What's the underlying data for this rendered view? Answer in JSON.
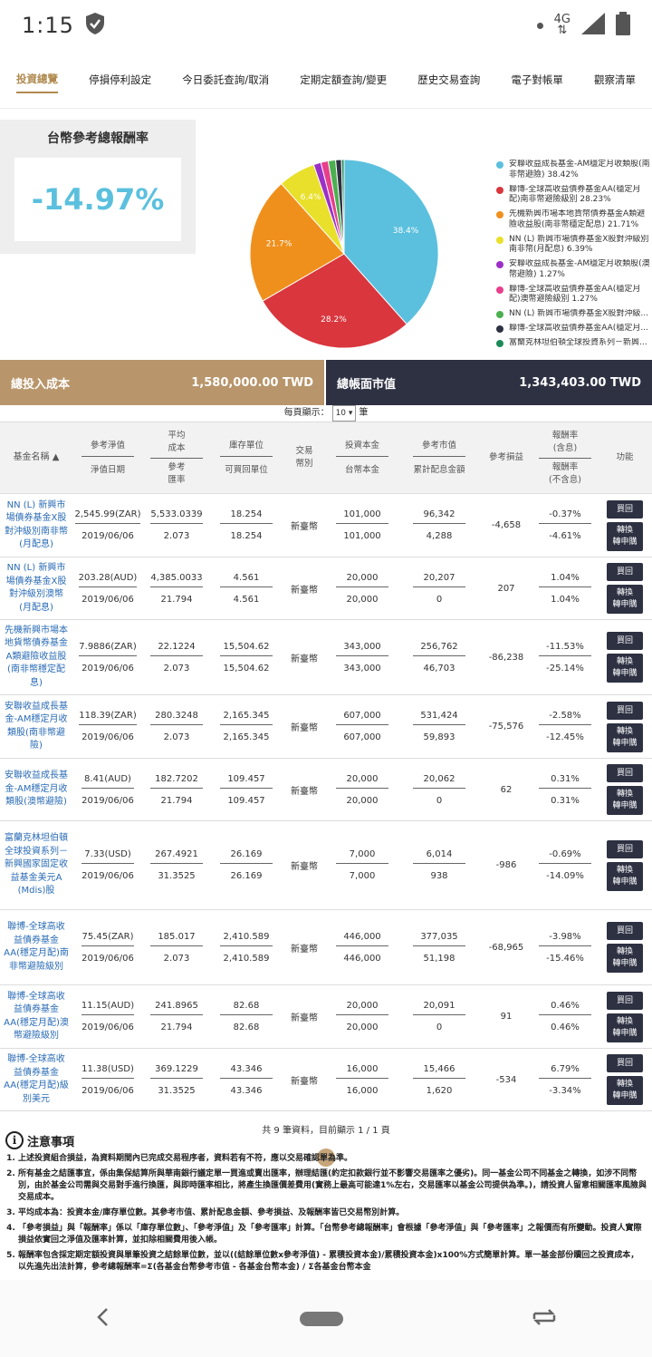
{
  "status": {
    "time": "1:15",
    "network": "4G"
  },
  "tabs": [
    "投資總覽",
    "停損停利設定",
    "今日委託查詢/取消",
    "定期定額查詢/變更",
    "歷史交易查詢",
    "電子對帳單",
    "觀察清單"
  ],
  "summary": {
    "title": "台幣參考總報酬率",
    "value": "-14.97%"
  },
  "chart_data": {
    "type": "pie",
    "slices": [
      {
        "label": "安聯收益成長基金-AM穩定月收類股(南非幣避險)",
        "value": 38.42,
        "color": "#5bc0de",
        "text": "38.4%"
      },
      {
        "label": "聯博-全球高收益債券基金AA(穩定月配)南非幣避險級別",
        "value": 28.23,
        "color": "#d9363e",
        "text": "28.2%"
      },
      {
        "label": "先機新興市場本地貨幣債券基金A類避險收益股(南非幣穩定配息)",
        "value": 21.71,
        "color": "#f0901c",
        "text": "21.7%"
      },
      {
        "label": "NN (L) 新興市場債券基金X股對沖級別南非幣(月配息)",
        "value": 6.39,
        "color": "#e8e02a",
        "text": "6.4%"
      },
      {
        "label": "安聯收益成長基金-AM穩定月收類股(澳幣避險)",
        "value": 1.27,
        "color": "#9b30c8",
        "text": ""
      },
      {
        "label": "聯博-全球高收益債券基金AA(穩定月配)澳幣避險級別",
        "value": 1.27,
        "color": "#e83e8c",
        "text": ""
      },
      {
        "label": "NN (L) 新興市場債券基金X股對沖級...",
        "value": 1.27,
        "color": "#4caf50",
        "text": ""
      },
      {
        "label": "聯博-全球高收益債券基金AA(穩定月...",
        "value": 1.0,
        "color": "#2d3142",
        "text": ""
      },
      {
        "label": "富蘭克林坦伯頓全球投資系列－新興...",
        "value": 0.44,
        "color": "#1e8a5a",
        "text": ""
      }
    ]
  },
  "legend": [
    "安聯收益成長基金-AM穩定月收類股(南非幣避險) 38.42%",
    "聯博-全球高收益債券基金AA(穩定月配)南非幣避險級別 28.23%",
    "先機新興市場本地貨幣債券基金A類避險收益股(南非幣穩定配息) 21.71%",
    "NN (L) 新興市場債券基金X股對沖級別南非幣(月配息) 6.39%",
    "安聯收益成長基金-AM穩定月收類股(澳幣避險) 1.27%",
    "聯博-全球高收益債券基金AA(穩定月配)澳幣避險級別 1.27%",
    "NN (L) 新興市場債券基金X股對沖級...",
    "聯博-全球高收益債券基金AA(穩定月...",
    "富蘭克林坦伯頓全球投資系列－新興..."
  ],
  "totals": {
    "cost_label": "總投入成本",
    "cost_value": "1,580,000.00  TWD",
    "mkt_label": "總帳面市值",
    "mkt_value": "1,343,403.00  TWD"
  },
  "pagesize": {
    "label": "每頁顯示：",
    "value": "10 ▾",
    "unit": "筆"
  },
  "headers": {
    "name": "基金名稱 ▲",
    "nav_a": "參考淨值",
    "nav_b": "淨值日期",
    "avg_a": "平均",
    "avg_b": "成本",
    "avg_c": "參考",
    "avg_d": "匯率",
    "unit_a": "庫存單位",
    "unit_b": "可買回單位",
    "cur_a": "交易",
    "cur_b": "幣別",
    "inv_a": "投資本金",
    "inv_b": "台幣本金",
    "mkt_a": "參考市值",
    "mkt_b": "累計配息金額",
    "pl": "參考損益",
    "rate_a": "報酬率",
    "rate_b": "(含息)",
    "rate_c": "報酬率",
    "rate_d": "(不含息)",
    "act": "功能"
  },
  "buttons": {
    "redeem": "買回",
    "switch_a": "轉換",
    "switch_b": "轉申購"
  },
  "rows": [
    {
      "name": "NN (L) 新興市場債券基金X股對沖級別南非幣(月配息)",
      "nav": "2,545.99(ZAR)",
      "date": "2019/06/06",
      "avg": "5,533.0339",
      "fx": "2.073",
      "unit": "18.254",
      "unit2": "18.254",
      "cur": "新臺幣",
      "inv": "101,000",
      "inv2": "101,000",
      "mkt": "96,342",
      "div": "4,288",
      "pl": "-4,658",
      "r1": "-0.37%",
      "r2": "-4.61%",
      "h": 70
    },
    {
      "name": "NN (L) 新興市場債券基金X股對沖級別澳幣(月配息)",
      "nav": "203.28(AUD)",
      "date": "2019/06/06",
      "avg": "4,385.0033",
      "fx": "21.794",
      "unit": "4.561",
      "unit2": "4.561",
      "cur": "新臺幣",
      "inv": "20,000",
      "inv2": "20,000",
      "mkt": "20,207",
      "div": "0",
      "pl": "207",
      "r1": "1.04%",
      "r2": "1.04%",
      "h": 69
    },
    {
      "name": "先機新興市場本地貨幣債券基金A類避險收益股(南非幣穩定配息)",
      "nav": "7.9886(ZAR)",
      "date": "2019/06/06",
      "avg": "22.1224",
      "fx": "2.073",
      "unit": "15,504.62",
      "unit2": "15,504.62",
      "cur": "新臺幣",
      "inv": "343,000",
      "inv2": "343,000",
      "mkt": "256,762",
      "div": "46,703",
      "pl": "-86,238",
      "r1": "-11.53%",
      "r2": "-25.14%",
      "h": 83
    },
    {
      "name": "安聯收益成長基金-AM穩定月收類股(南非幣避險)",
      "nav": "118.39(ZAR)",
      "date": "2019/06/06",
      "avg": "280.3248",
      "fx": "2.073",
      "unit": "2,165.345",
      "unit2": "2,165.345",
      "cur": "新臺幣",
      "inv": "607,000",
      "inv2": "607,000",
      "mkt": "531,424",
      "div": "59,893",
      "pl": "-75,576",
      "r1": "-2.58%",
      "r2": "-12.45%",
      "h": 70
    },
    {
      "name": "安聯收益成長基金-AM穩定月收類股(澳幣避險)",
      "nav": "8.41(AUD)",
      "date": "2019/06/06",
      "avg": "182.7202",
      "fx": "21.794",
      "unit": "109.457",
      "unit2": "109.457",
      "cur": "新臺幣",
      "inv": "20,000",
      "inv2": "20,000",
      "mkt": "20,062",
      "div": "0",
      "pl": "62",
      "r1": "0.31%",
      "r2": "0.31%",
      "h": 69
    },
    {
      "name": "富蘭克林坦伯頓全球投資系列－新興國家固定收益基金美元A (Mdis)股",
      "nav": "7.33(USD)",
      "date": "2019/06/06",
      "avg": "267.4921",
      "fx": "31.3525",
      "unit": "26.169",
      "unit2": "26.169",
      "cur": "新臺幣",
      "inv": "7,000",
      "inv2": "7,000",
      "mkt": "6,014",
      "div": "938",
      "pl": "-986",
      "r1": "-0.69%",
      "r2": "-14.09%",
      "h": 98
    },
    {
      "name": "聯博-全球高收益債券基金AA(穩定月配)南非幣避險級別",
      "nav": "75.45(ZAR)",
      "date": "2019/06/06",
      "avg": "185.017",
      "fx": "2.073",
      "unit": "2,410.589",
      "unit2": "2,410.589",
      "cur": "新臺幣",
      "inv": "446,000",
      "inv2": "446,000",
      "mkt": "377,035",
      "div": "51,198",
      "pl": "-68,965",
      "r1": "-3.98%",
      "r2": "-15.46%",
      "h": 83
    },
    {
      "name": "聯博-全球高收益債券基金AA(穩定月配)澳幣避險級別",
      "nav": "11.15(AUD)",
      "date": "2019/06/06",
      "avg": "241.8965",
      "fx": "21.794",
      "unit": "82.68",
      "unit2": "82.68",
      "cur": "新臺幣",
      "inv": "20,000",
      "inv2": "20,000",
      "mkt": "20,091",
      "div": "0",
      "pl": "91",
      "r1": "0.46%",
      "r2": "0.46%",
      "h": 70
    },
    {
      "name": "聯博-全球高收益債券基金AA(穩定月配)級別美元",
      "nav": "11.38(USD)",
      "date": "2019/06/06",
      "avg": "369.1229",
      "fx": "31.3525",
      "unit": "43.346",
      "unit2": "43.346",
      "cur": "新臺幣",
      "inv": "16,000",
      "inv2": "16,000",
      "mkt": "15,466",
      "div": "1,620",
      "pl": "-534",
      "r1": "6.79%",
      "r2": "-3.34%",
      "h": 69
    }
  ],
  "footer": {
    "info": "共 9 筆資料，目前顯示 1 / 1 頁",
    "page": "1"
  },
  "notes": {
    "title": "注意事項",
    "items": [
      "上述投資組合損益，為資料期間內已完成交易程序者，資料若有不符，應以交易確認單為準。",
      "所有基金之結匯事宜，係由集保結算所與華南銀行議定單一買進或賣出匯率，辦理結匯(約定扣款銀行並不影響交易匯率之優劣)。同一基金公司不同基金之轉換，如涉不同幣別，由於基金公司需與交易對手進行換匯，與即時匯率相比，將產生換匯價差費用(實務上最高可能達1%左右，交易匯率以基金公司提供為準。)，請投資人留意相關匯率風險與交易成本。",
      "平均成本為：投資本金/庫存單位數。其參考市值、累計配息金額、參考損益、及報酬率皆已交易幣別計算。",
      "「參考損益」與「報酬率」係以「庫存單位數」、「參考淨值」及「參考匯率」計算。「台幣參考總報酬率」會根據「參考淨值」與「參考匯率」之報價而有所變動。投資人實際損益依實回之淨值及匯率計算，並扣除相關費用後入帳。",
      "報酬率包含採定期定額投資與單筆投資之結餘單位數，並以((結餘單位數x參考淨值) - 累積投資本金)/累積投資本金)x100%方式簡單計算。單一基金部份贖回之投資成本，以先進先出法計算，參考總報酬率=Σ(各基金台幣參考市值 - 各基金台幣本金) / Σ各基金台幣本金"
    ]
  }
}
